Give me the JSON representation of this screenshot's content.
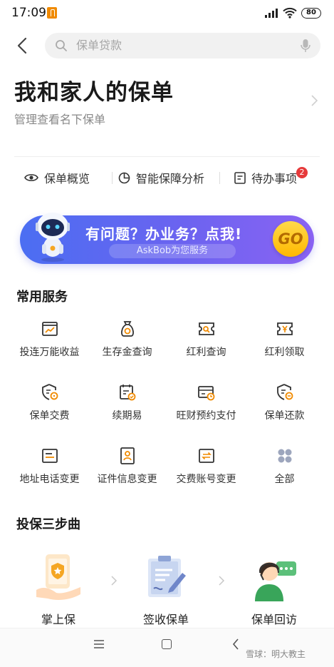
{
  "status_bar": {
    "time": "17:09",
    "battery": "80"
  },
  "search": {
    "placeholder": "保单贷款"
  },
  "header": {
    "title": "我和家人的保单",
    "subtitle": "管理查看名下保单"
  },
  "tabs": [
    {
      "label": "保单概览",
      "icon": "eye-icon"
    },
    {
      "label": "智能保障分析",
      "icon": "pie-chart-icon"
    },
    {
      "label": "待办事项",
      "icon": "todo-list-icon",
      "badge": "2"
    }
  ],
  "banner": {
    "title": "有问题？办业务？点我!",
    "subtitle": "AskBob为您服务",
    "button": "GO"
  },
  "services": {
    "title": "常用服务",
    "items": [
      {
        "label": "投连万能收益",
        "icon": "income-chart-icon"
      },
      {
        "label": "生存金查询",
        "icon": "money-bag-icon"
      },
      {
        "label": "红利查询",
        "icon": "ticket-search-icon"
      },
      {
        "label": "红利领取",
        "icon": "yen-ticket-icon"
      },
      {
        "label": "保单交费",
        "icon": "policy-pay-icon"
      },
      {
        "label": "续期易",
        "icon": "calendar-check-icon"
      },
      {
        "label": "旺财预约支付",
        "icon": "card-clock-icon"
      },
      {
        "label": "保单还款",
        "icon": "policy-repay-icon"
      },
      {
        "label": "地址电话变更",
        "icon": "address-card-icon"
      },
      {
        "label": "证件信息变更",
        "icon": "id-card-icon"
      },
      {
        "label": "交费账号变更",
        "icon": "account-switch-icon"
      },
      {
        "label": "全部",
        "icon": "grid-all-icon"
      }
    ]
  },
  "steps": {
    "title": "投保三步曲",
    "items": [
      {
        "label": "掌上保",
        "icon": "hand-shield-icon"
      },
      {
        "label": "签收保单",
        "icon": "sign-document-icon"
      },
      {
        "label": "保单回访",
        "icon": "customer-service-icon"
      }
    ]
  },
  "watermark": "雪球：明大教主",
  "colors": {
    "accent": "#f08a00",
    "banner_start": "#4b6ef2",
    "banner_end": "#8a63f3",
    "badge": "#e6393a"
  }
}
